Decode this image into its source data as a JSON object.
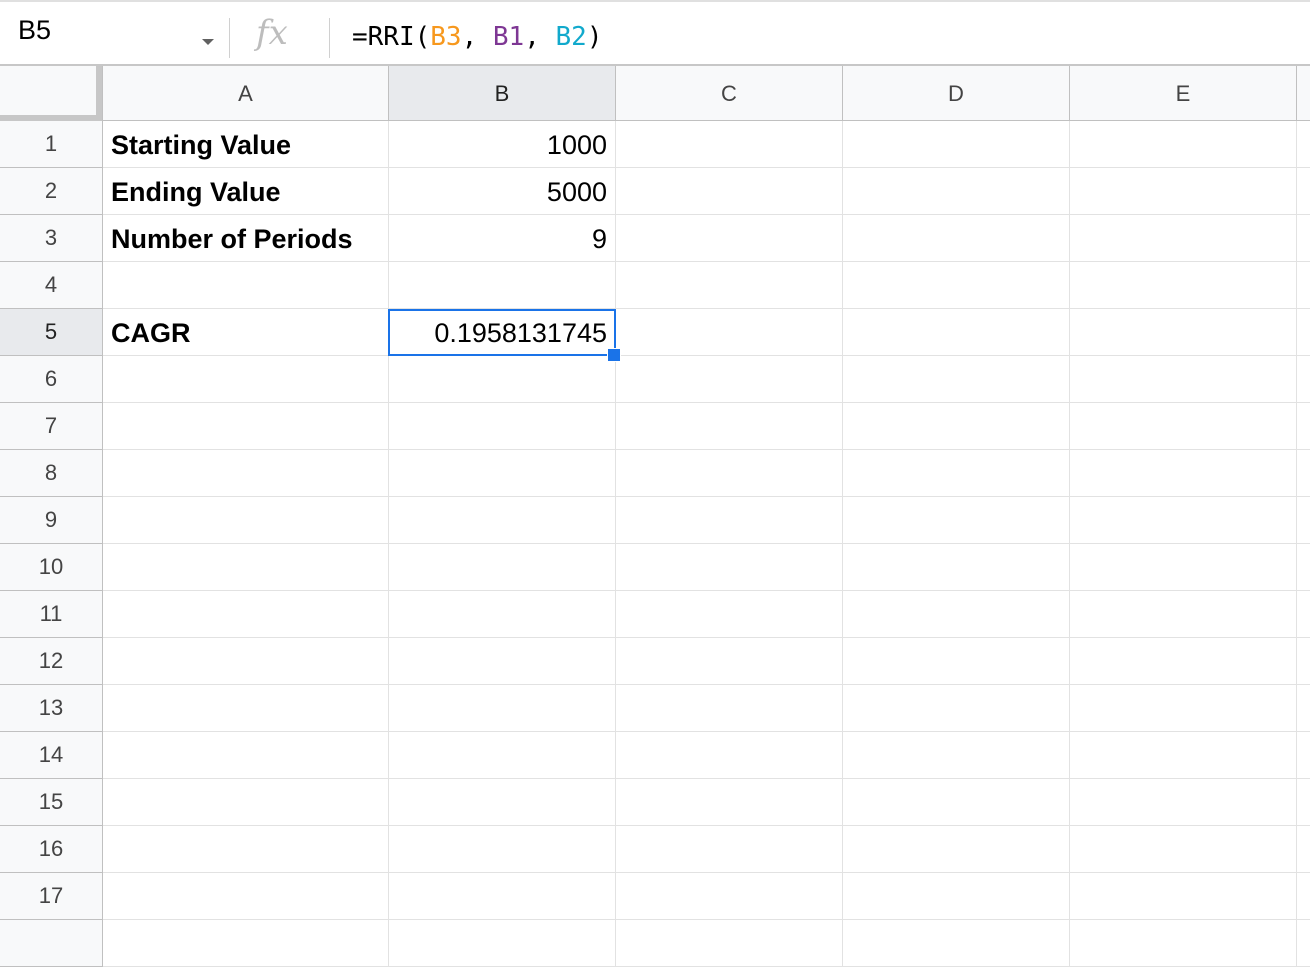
{
  "formula_bar": {
    "name_box": "B5",
    "fx_icon": "function-icon",
    "formula_parts": [
      {
        "text": "=RRI(",
        "color": "#000000"
      },
      {
        "text": "B3",
        "color": "#f7981d"
      },
      {
        "text": ", ",
        "color": "#000000"
      },
      {
        "text": "B1",
        "color": "#7e3794"
      },
      {
        "text": ", ",
        "color": "#000000"
      },
      {
        "text": "B2",
        "color": "#11a9cc"
      },
      {
        "text": ")",
        "color": "#000000"
      }
    ]
  },
  "columns": [
    "A",
    "B",
    "C",
    "D",
    "E"
  ],
  "selected_column": "B",
  "rows": [
    "1",
    "2",
    "3",
    "4",
    "5",
    "6",
    "7",
    "8",
    "9",
    "10",
    "11",
    "12",
    "13",
    "14",
    "15",
    "16",
    "17"
  ],
  "selected_row": "5",
  "cells": {
    "A1": "Starting Value",
    "B1": "1000",
    "A2": "Ending Value",
    "B2": "5000",
    "A3": "Number of Periods",
    "B3": "9",
    "A5": "CAGR",
    "B5": "0.1958131745"
  },
  "selection_color": "#1a73e8"
}
